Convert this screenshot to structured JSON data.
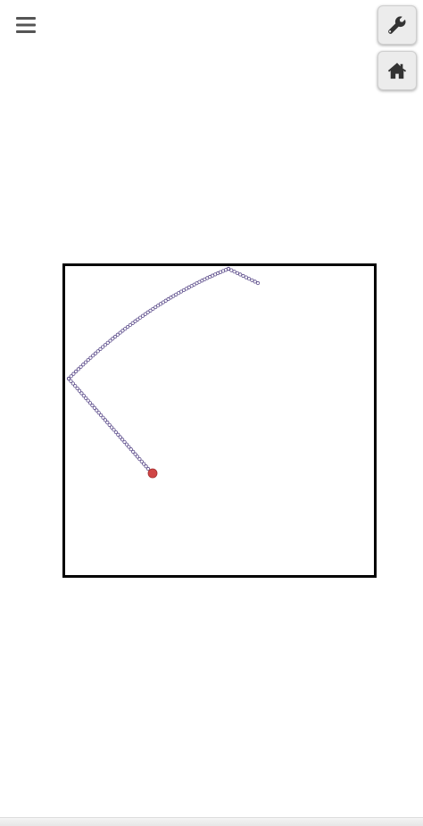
{
  "toolbar": {
    "menu_icon": "hamburger-menu-icon",
    "settings_icon": "wrench-icon",
    "home_icon": "home-icon"
  },
  "simulation": {
    "box_border_color": "#000000",
    "trail_color": "#5b4b8a",
    "ball_color": "#d04545"
  }
}
